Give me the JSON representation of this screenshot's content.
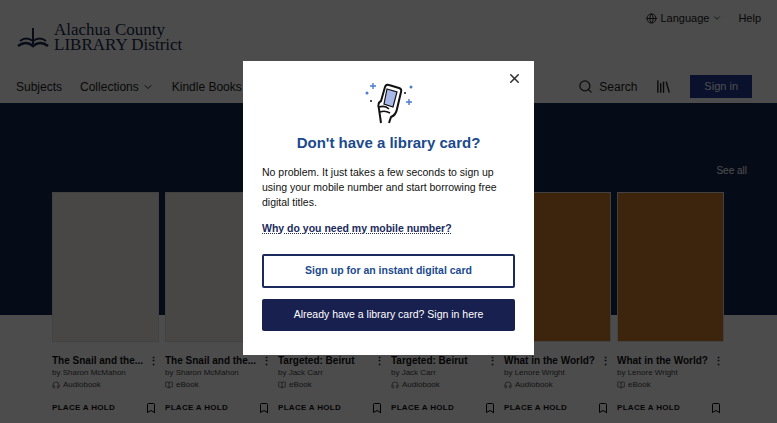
{
  "header": {
    "logo_lines": [
      "Alachua County",
      "LIBRARY District"
    ],
    "language": "Language",
    "help": "Help",
    "search": "Search",
    "sign_in": "Sign in"
  },
  "nav": [
    {
      "label": "Subjects",
      "dropdown": false
    },
    {
      "label": "Collections",
      "dropdown": true
    },
    {
      "label": "Kindle Books",
      "dropdown": false
    }
  ],
  "banner": {
    "see_all": "See all"
  },
  "books": [
    {
      "title": "The Snail and the...",
      "author": "by Sharon McMahon",
      "format": "Audiobook",
      "kind": "audio",
      "action": "PLACE A HOLD",
      "color": "#f3efe6"
    },
    {
      "title": "The Snail and the...",
      "author": "by Sharon McMahon",
      "format": "eBook",
      "kind": "ebook",
      "action": "PLACE A HOLD",
      "color": "#f3efe6"
    },
    {
      "title": "Targeted: Beirut",
      "author": "by Jack Carr",
      "format": "eBook",
      "kind": "ebook",
      "action": "PLACE A HOLD",
      "color": "#2a3a4a"
    },
    {
      "title": "Targeted: Beirut",
      "author": "by Jack Carr",
      "format": "Audiobook",
      "kind": "audio",
      "action": "PLACE A HOLD",
      "color": "#2a3a4a"
    },
    {
      "title": "What in the World?",
      "author": "by Lenore Wright",
      "format": "Audiobook",
      "kind": "audio",
      "action": "PLACE A HOLD",
      "color": "#c8782e"
    },
    {
      "title": "What in the World?",
      "author": "by Lenore Wright",
      "format": "eBook",
      "kind": "ebook",
      "action": "PLACE A HOLD",
      "color": "#c8782e"
    }
  ],
  "modal": {
    "title": "Don't have a library card?",
    "body": "No problem. It just takes a few seconds to sign up using your mobile number and start borrowing free digital titles.",
    "link": "Why do you need my mobile number?",
    "primary": "Sign up for an instant digital card",
    "secondary": "Already have a library card? Sign in here"
  }
}
